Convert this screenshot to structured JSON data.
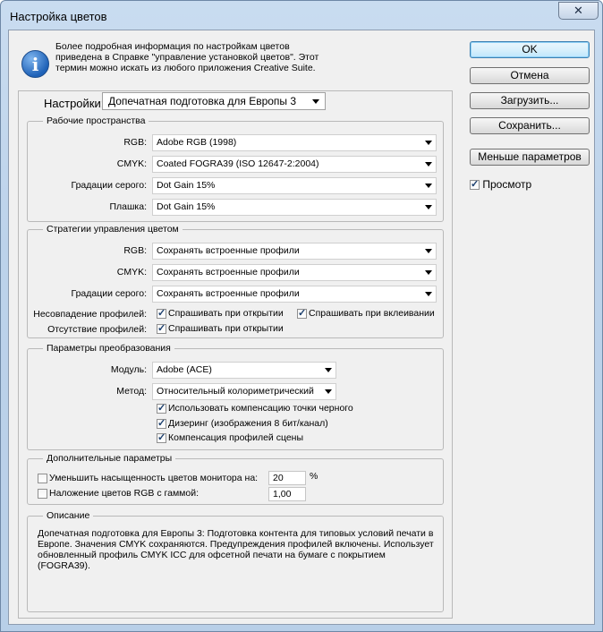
{
  "window": {
    "title": "Настройка цветов",
    "close_label": "✕"
  },
  "info": {
    "lines": [
      "Более подробная информация по настройкам цветов",
      "приведена в Справке \"управление установкой цветов\". Этот",
      "термин можно искать из любого приложения Creative Suite."
    ]
  },
  "buttons": {
    "ok": "OK",
    "cancel": "Отмена",
    "load": "Загрузить...",
    "save": "Сохранить...",
    "fewer": "Меньше параметров"
  },
  "preview": {
    "label": "Просмотр",
    "checked": true
  },
  "settings": {
    "label": "Настройки:",
    "value": "Допечатная подготовка для Европы 3"
  },
  "working_spaces": {
    "legend": "Рабочие пространства",
    "rgb_label": "RGB:",
    "rgb_value": "Adobe RGB (1998)",
    "cmyk_label": "CMYK:",
    "cmyk_value": "Coated FOGRA39 (ISO 12647-2:2004)",
    "gray_label": "Градации серого:",
    "gray_value": "Dot Gain 15%",
    "spot_label": "Плашка:",
    "spot_value": "Dot Gain 15%"
  },
  "policies": {
    "legend": "Стратегии управления цветом",
    "rgb_label": "RGB:",
    "rgb_value": "Сохранять встроенные профили",
    "cmyk_label": "CMYK:",
    "cmyk_value": "Сохранять встроенные профили",
    "gray_label": "Градации серого:",
    "gray_value": "Сохранять встроенные профили",
    "mismatch_label": "Несовпадение профилей:",
    "ask_open": "Спрашивать при открытии",
    "ask_paste": "Спрашивать при вклеивании",
    "missing_label": "Отсутствие профилей:",
    "missing_ask_open": "Спрашивать при открытии"
  },
  "conversion": {
    "legend": "Параметры преобразования",
    "engine_label": "Модуль:",
    "engine_value": "Adobe (ACE)",
    "intent_label": "Метод:",
    "intent_value": "Относительный колориметрический",
    "bpc": "Использовать компенсацию точки черного",
    "dither": "Дизеринг (изображения 8 бит/канал)",
    "scene": "Компенсация профилей сцены"
  },
  "advanced": {
    "legend": "Дополнительные параметры",
    "desaturate_label": "Уменьшить насыщенность цветов монитора на:",
    "desaturate_value": "20",
    "desaturate_unit": "%",
    "blend_label": "Наложение цветов RGB с гаммой:",
    "blend_value": "1,00"
  },
  "description": {
    "legend": "Описание",
    "text": "Допечатная подготовка для Европы 3:  Подготовка контента для типовых условий печати в Европе. Значения CMYK сохраняются. Предупреждения профилей включены. Использует обновленный профиль CMYK ICC для офсетной печати на бумаге с покрытием (FOGRA39)."
  }
}
